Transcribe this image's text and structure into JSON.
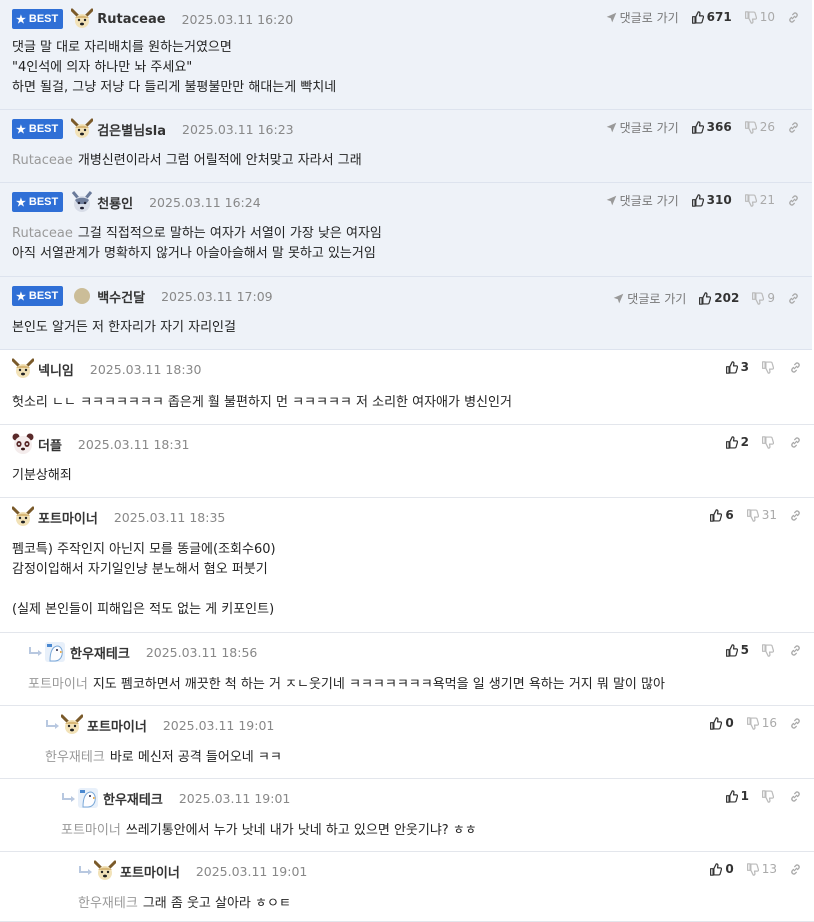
{
  "reply_label": "댓글로 가기",
  "best_label": "BEST",
  "comments": [
    {
      "best": true,
      "avatar": "dog-avatar",
      "nick": "Rutaceae",
      "date": "2025.03.11 16:20",
      "up": "671",
      "down": "10",
      "mention": "",
      "lines": [
        "댓글 말 대로 자리배치를 원하는거였으면",
        "\"4인석에 의자 하나만 놔 주세요\"",
        "하면 될걸, 그냥 저냥 다 들리게 불평불만만 해대는게 빡치네"
      ]
    },
    {
      "best": true,
      "avatar": "dog-avatar",
      "nick": "검은별님sla",
      "date": "2025.03.11 16:23",
      "up": "366",
      "down": "26",
      "mention": "Rutaceae",
      "lines": [
        "개병신련이라서 그럼 어릴적에 안처맞고 자라서 그래"
      ]
    },
    {
      "best": true,
      "avatar": "husky-avatar",
      "nick": "천룡인",
      "date": "2025.03.11 16:24",
      "up": "310",
      "down": "21",
      "mention": "Rutaceae",
      "lines": [
        "그걸 직접적으로 말하는 여자가 서열이 가장 낮은 여자임",
        "아직 서열관계가 명확하지 않거나 아슬아슬해서 말 못하고 있는거임"
      ]
    },
    {
      "best": true,
      "avatar": "circle-avatar",
      "nick": "백수건달",
      "date": "2025.03.11 17:09",
      "up": "202",
      "down": "9",
      "mention": "",
      "lines": [
        "본인도 알거든 저 한자리가 자기 자리인걸"
      ]
    },
    {
      "best": false,
      "avatar": "dog-avatar",
      "nick": "넥니임",
      "date": "2025.03.11 18:30",
      "up": "3",
      "down": "",
      "mention": "",
      "lines": [
        "헛소리 ㄴㄴ ㅋㅋㅋㅋㅋㅋㅋ 좁은게 훨 불편하지 먼 ㅋㅋㅋㅋㅋ 저 소리한 여자애가 병신인거"
      ]
    },
    {
      "best": false,
      "avatar": "panda-avatar",
      "nick": "더플",
      "date": "2025.03.11 18:31",
      "up": "2",
      "down": "",
      "mention": "",
      "lines": [
        "기분상해죄"
      ]
    },
    {
      "best": false,
      "avatar": "dog-avatar",
      "nick": "포트마이너",
      "date": "2025.03.11 18:35",
      "up": "6",
      "down": "31",
      "mention": "",
      "lines": [
        "펨코특) 주작인지 아닌지 모를 똥글에(조회수60)",
        "감정이입해서 자기일인냥 분노해서 혐오 퍼붓기",
        "",
        "(실제 본인들이 피해입은 적도 없는 게 키포인트)"
      ]
    },
    {
      "best": false,
      "avatar": "bird-avatar",
      "nick": "한우재테크",
      "date": "2025.03.11 18:56",
      "up": "5",
      "down": "",
      "mention": "포트마이너",
      "lines": [
        "지도 펨코하면서 깨끗한 척 하는 거 ㅈㄴ웃기네 ㅋㅋㅋㅋㅋㅋㅋ욕먹을 일 생기면 욕하는 거지 뭐 말이 많아"
      ]
    },
    {
      "best": false,
      "avatar": "dog-avatar",
      "nick": "포트마이너",
      "date": "2025.03.11 19:01",
      "up": "0",
      "down": "16",
      "mention": "한우재테크",
      "lines": [
        "바로 메신저 공격 들어오네 ㅋㅋ"
      ]
    },
    {
      "best": false,
      "avatar": "bird-avatar",
      "nick": "한우재테크",
      "date": "2025.03.11 19:01",
      "up": "1",
      "down": "",
      "mention": "포트마이너",
      "lines": [
        "쓰레기통안에서 누가 낫네 내가 낫네 하고 있으면 안웃기냐? ㅎㅎ"
      ]
    },
    {
      "best": false,
      "avatar": "dog-avatar",
      "nick": "포트마이너",
      "date": "2025.03.11 19:01",
      "up": "0",
      "down": "13",
      "mention": "한우재테크",
      "lines": [
        "그래 좀 웃고 살아라 ㅎㅇㅌ"
      ]
    }
  ]
}
